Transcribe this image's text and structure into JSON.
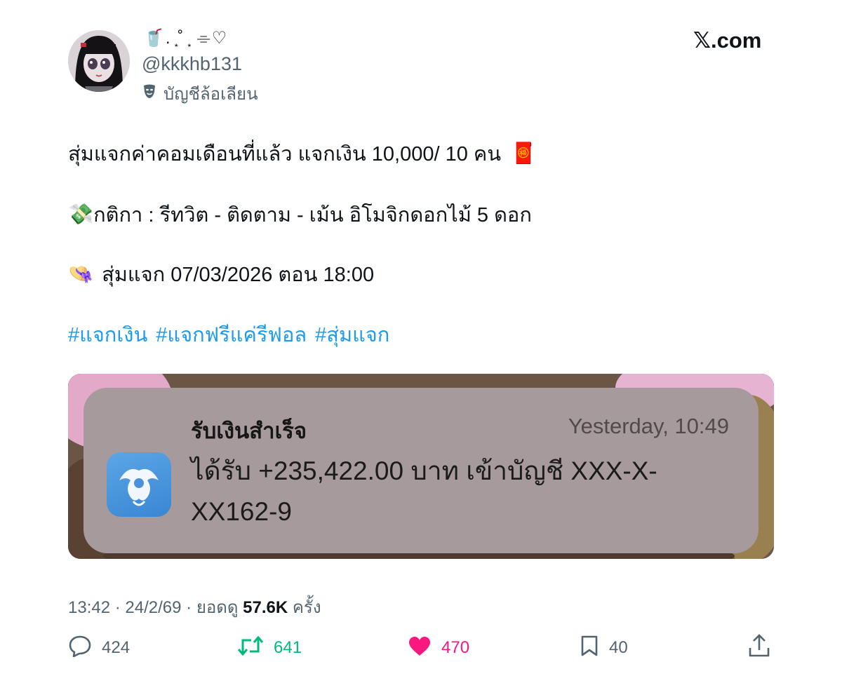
{
  "brand": {
    "site": "𝕏.com"
  },
  "author": {
    "display_name": "🥤. ͙˚ ͙ ⌯♡",
    "handle": "@kkkhb131",
    "account_type": "บัญชีล้อเลียน",
    "account_type_icon": "parody-mask-icon"
  },
  "tweet": {
    "line1": "สุ่มแจกค่าคอมเดือนที่แล้ว  แจกเงิน 10,000/ 10  คน",
    "line1_emoji": "🧧",
    "line2_emoji": "💸",
    "line2": "กติกา : รีทวิต - ติดตาม - เม้น อิโมจิกดอกไม้ 5 ดอก",
    "line3_emoji": "👒",
    "line3": "สุ่มแจก 07/03/2026 ตอน 18:00",
    "hashtags": [
      "#แจกเงิน",
      "#แจกฟรีแค่รีฟอล",
      "#สุ่มแจก"
    ]
  },
  "notification": {
    "title": "รับเงินสำเร็จ",
    "time": "Yesterday, 10:49",
    "body": "ได้รับ +235,422.00 บาท เข้าบัญชี XXX-X-XX162-9",
    "app_icon": "krungthai-bank-icon"
  },
  "meta": {
    "time": "13:42",
    "date": "24/2/69",
    "views_label": "ยอดดู",
    "views": "57.6K",
    "views_suffix": "ครั้ง"
  },
  "actions": {
    "replies": "424",
    "retweets": "641",
    "likes": "470",
    "bookmarks": "40"
  },
  "colors": {
    "link": "#1d9bf0",
    "retweet": "#00ba7c",
    "like": "#f91880",
    "muted": "#536471"
  }
}
